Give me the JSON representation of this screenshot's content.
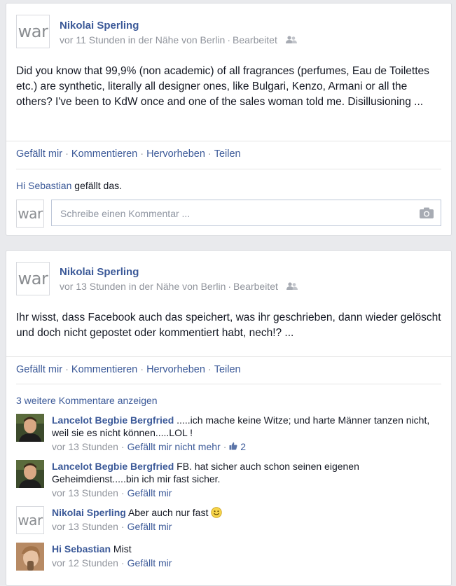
{
  "posts": [
    {
      "avatar_text": "war",
      "author": "Nikolai Sperling",
      "time": "vor 11 Stunden in der Nähe von Berlin",
      "edited": "Bearbeitet",
      "text": "Did you know that 99,9% (non academic) of all fragrances (perfumes, Eau de Toilettes etc.) are synthetic, literally all designer ones, like Bulgari, Kenzo, Armani or all the others? I've been to KdW once and one of the sales woman told me. Disillusioning ...",
      "actions": [
        "Gefällt mir",
        "Kommentieren",
        "Hervorheben",
        "Teilen"
      ],
      "likes": {
        "name": "Hi Sebastian",
        "suffix": " gefällt das."
      },
      "comment_placeholder": "Schreibe einen Kommentar ...",
      "commenter_avatar_text": "war"
    },
    {
      "avatar_text": "war",
      "author": "Nikolai Sperling",
      "time": "vor 13 Stunden in der Nähe von Berlin",
      "edited": "Bearbeitet",
      "text": "Ihr wisst, dass Facebook auch das speichert, was ihr geschrieben, dann wieder gelöscht und doch nicht gepostet oder kommentiert habt, nech!? ...",
      "actions": [
        "Gefällt mir",
        "Kommentieren",
        "Hervorheben",
        "Teilen"
      ],
      "more_comments": "3 weitere Kommentare anzeigen",
      "comments": [
        {
          "author": "Lancelot Begbie Bergfried",
          "text": ".....ich mache keine Witze; und harte Männer tanzen nicht, weil sie es nicht können.....LOL !",
          "time": "vor 13 Stunden",
          "like": "Gefällt mir nicht mehr",
          "like_count": "2"
        },
        {
          "author": "Lancelot Begbie Bergfried",
          "text": "FB. hat sicher auch schon seinen eigenen Geheimdienst.....bin ich mir fast sicher.",
          "time": "vor 13 Stunden",
          "like": "Gefällt mir"
        },
        {
          "author": "Nikolai Sperling",
          "avatar_text": "war",
          "text": "Aber auch nur fast",
          "time": "vor 13 Stunden",
          "like": "Gefällt mir"
        },
        {
          "author": "Hi Sebastian",
          "text": "Mist",
          "time": "vor 12 Stunden",
          "like": "Gefällt mir"
        }
      ]
    }
  ],
  "icons": {
    "friends": "friends-icon",
    "camera": "camera-icon",
    "thumbs_up": "thumbs-up-icon",
    "smiley": "smiley-icon"
  },
  "colors": {
    "link": "#3b5998",
    "meta": "#90949c",
    "background": "#e9eaed"
  }
}
